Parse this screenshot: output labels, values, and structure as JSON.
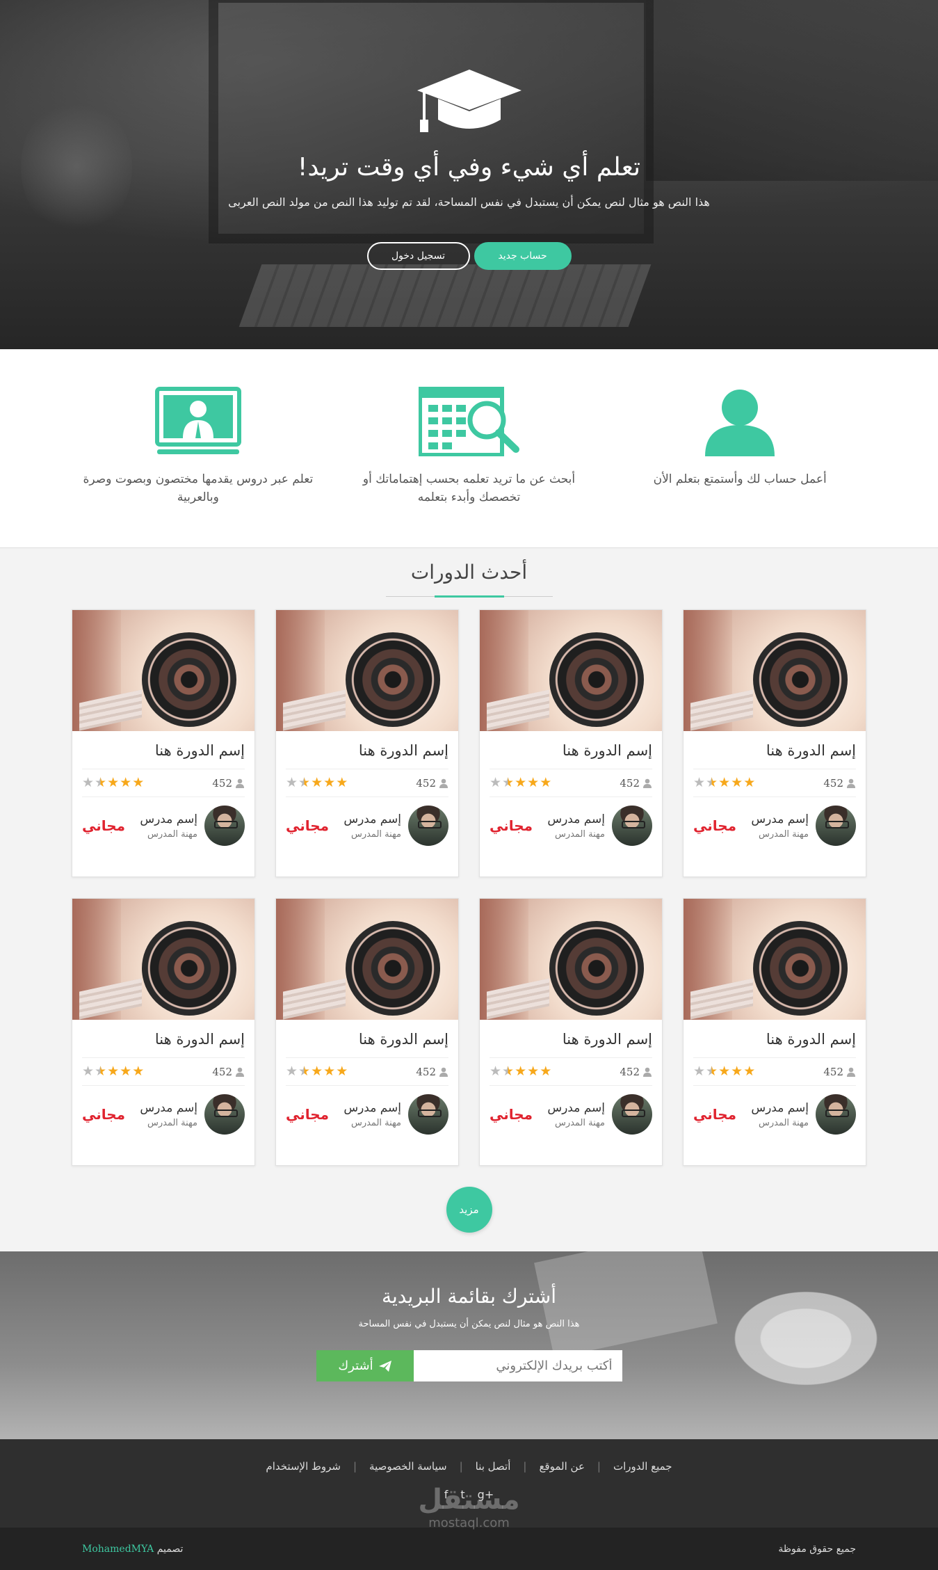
{
  "hero": {
    "title": "تعلم أي شيء وفي أي وقت تريد!",
    "subtitle": "هذا النص هو مثال لنص يمكن أن يستبدل في نفس المساحة، لقد تم توليد هذا النص من مولد النص العربى",
    "btn_new": "حساب جديد",
    "btn_login": "تسجيل دخول"
  },
  "features": [
    {
      "icon": "user-icon",
      "text": "أعمل حساب لك وأستمتع بتعلم الأن"
    },
    {
      "icon": "search-calendar-icon",
      "text": "أبحث عن ما تريد تعلمه بحسب إهتماماتك أو تخصصك وأبدء بتعلمه"
    },
    {
      "icon": "video-lesson-icon",
      "text": "تعلم عبر دروس يقدمها مختصون وبصوت وصرة وبالعربية"
    }
  ],
  "courses": {
    "title": "أحدث الدورات",
    "items": [
      {
        "name": "إسم الدورة هنا",
        "count": "452",
        "rating": 3.5,
        "teacher": "إسم مدرس",
        "job": "مهنة المدرس",
        "price": "مجاني"
      },
      {
        "name": "إسم الدورة هنا",
        "count": "452",
        "rating": 3.5,
        "teacher": "إسم مدرس",
        "job": "مهنة المدرس",
        "price": "مجاني"
      },
      {
        "name": "إسم الدورة هنا",
        "count": "452",
        "rating": 3.5,
        "teacher": "إسم مدرس",
        "job": "مهنة المدرس",
        "price": "مجاني"
      },
      {
        "name": "إسم الدورة هنا",
        "count": "452",
        "rating": 3.5,
        "teacher": "إسم مدرس",
        "job": "مهنة المدرس",
        "price": "مجاني"
      },
      {
        "name": "إسم الدورة هنا",
        "count": "452",
        "rating": 3.5,
        "teacher": "إسم مدرس",
        "job": "مهنة المدرس",
        "price": "مجاني"
      },
      {
        "name": "إسم الدورة هنا",
        "count": "452",
        "rating": 3.5,
        "teacher": "إسم مدرس",
        "job": "مهنة المدرس",
        "price": "مجاني"
      },
      {
        "name": "إسم الدورة هنا",
        "count": "452",
        "rating": 3.5,
        "teacher": "إسم مدرس",
        "job": "مهنة المدرس",
        "price": "مجاني"
      },
      {
        "name": "إسم الدورة هنا",
        "count": "452",
        "rating": 3.5,
        "teacher": "إسم مدرس",
        "job": "مهنة المدرس",
        "price": "مجاني"
      }
    ],
    "more": "مزيد"
  },
  "newsletter": {
    "title": "أشترك بقائمة البريدية",
    "subtitle": "هذا النص هو مثال لنص يمكن أن يستبدل في نفس المساحة",
    "placeholder": "أكتب بريدك الإلكتروني",
    "button": "أشترك"
  },
  "footer": {
    "links": [
      "جميع الدورات",
      "عن الموقع",
      "أتصل بنا",
      "سياسة الخصوصية",
      "شروط الإستخدام"
    ],
    "social": [
      "f",
      "t",
      "g+"
    ],
    "watermark_ar": "مستقل",
    "watermark_en": "mostaql.com",
    "copyright": "جميع حقوق مفوظة",
    "credit_label": "تصميم",
    "credit_name": "MohamedMYA"
  },
  "colors": {
    "accent": "#3ec8a1",
    "price": "#e0232f",
    "star": "#f7a81b",
    "subscribe": "#5cb85c"
  }
}
